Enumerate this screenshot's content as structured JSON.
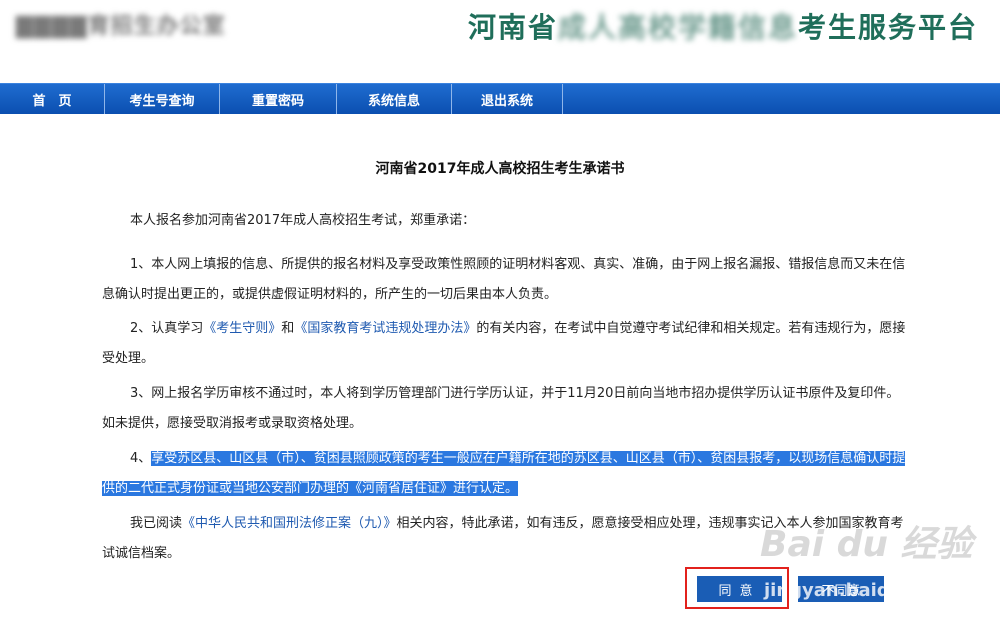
{
  "header": {
    "left_title": "▇▇▇▇育招生办公室",
    "right_title_prefix": "河南省",
    "right_title_blurred": "成人高校学籍信息",
    "right_title_suffix": "考生服务平台"
  },
  "nav": {
    "items": [
      "首　页",
      "考生号查询",
      "重置密码",
      "系统信息",
      "退出系统"
    ]
  },
  "document": {
    "title": "河南省2017年成人高校招生考生承诺书",
    "intro": "本人报名参加河南省2017年成人高校招生考试，郑重承诺：",
    "p1": "1、本人网上填报的信息、所提供的报名材料及享受政策性照顾的证明材料客观、真实、准确，由于网上报名漏报、错报信息而又未在信息确认时提出更正的，或提供虚假证明材料的，所产生的一切后果由本人负责。",
    "p2_a": "2、认真学习",
    "p2_link1": "《考生守则》",
    "p2_b": "和",
    "p2_link2": "《国家教育考试违规处理办法》",
    "p2_c": "的有关内容，在考试中自觉遵守考试纪律和相关规定。若有违规行为，愿接受处理。",
    "p3": "3、网上报名学历审核不通过时，本人将到学历管理部门进行学历认证，并于11月20日前向当地市招办提供学历认证书原件及复印件。如未提供，愿接受取消报考或录取资格处理。",
    "p4_num": "4、",
    "p4_hl": "享受苏区县、山区县（市）、贫困县照顾政策的考生一般应在户籍所在地的苏区县、山区县（市）、贫困县报考，以现场信息确认时提供的二代正式身份证或当地公安部门办理的《河南省居住证》进行认定。",
    "p5_a": "我已阅读",
    "p5_link": "《中华人民共和国刑法修正案（九）》",
    "p5_b": "相关内容，特此承诺，如有违反，愿意接受相应处理，违规事实记入本人参加国家教育考试诚信档案。"
  },
  "buttons": {
    "agree": "同意",
    "disagree": "不同意"
  },
  "watermark": {
    "text": "Bai du 经验",
    "sub": "jingyan.baidu"
  }
}
